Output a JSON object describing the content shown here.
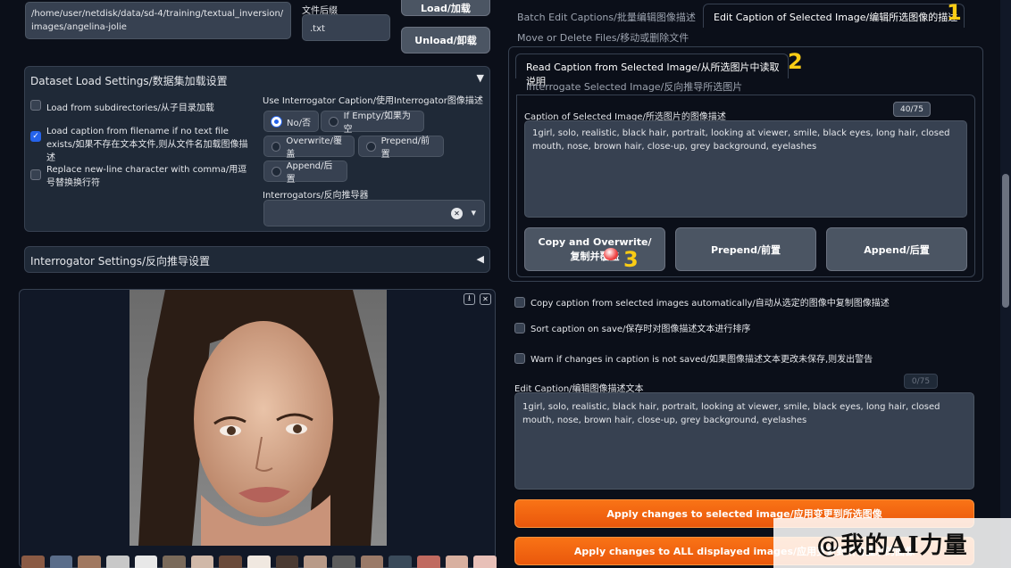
{
  "left": {
    "path_value": "/home/user/netdisk/data/sd-4/training/textual_inversion/images/angelina-jolie",
    "suffix_label": "文件后缀",
    "suffix_value": ".txt",
    "load_button": "Load/加载",
    "unload_button": "Unload/卸载",
    "dataset_settings": {
      "title": "Dataset Load Settings/数据集加载设置",
      "options": [
        {
          "label": "Load from subdirectories/从子目录加载",
          "checked": false
        },
        {
          "label": "Load caption from filename if no text file exists/如果不存在文本文件,则从文件名加载图像描述",
          "checked": true
        },
        {
          "label": "Replace new-line character with comma/用逗号替换换行符",
          "checked": false
        }
      ],
      "interrogator_caption_label": "Use Interrogator Caption/使用Interrogator图像描述",
      "radio_options": [
        "No/否",
        "If Empty/如果为空",
        "Overwrite/覆盖",
        "Prepend/前置",
        "Append/后置"
      ],
      "interrogators_label": "Interrogators/反向推导器"
    },
    "interrogator_settings": {
      "title": "Interrogator Settings/反向推导设置"
    }
  },
  "right": {
    "tabs": [
      "Batch Edit Captions/批量编辑图像描述",
      "Edit Caption of Selected Image/编辑所选图像的描述",
      "Move or Delete Files/移动或删除文件"
    ],
    "subtabs": [
      "Read Caption from Selected Image/从所选图片中读取说明",
      "Interrogate Selected Image/反向推导所选图片"
    ],
    "caption_label": "Caption of Selected Image/所选图片的图像描述",
    "caption_counter": "40/75",
    "caption_text": "1girl, solo, realistic, black hair, portrait, looking at viewer, smile, black eyes, long hair, closed mouth, nose, brown hair, close-up, grey background, eyelashes",
    "action_buttons": [
      "Copy and Overwrite/复制并覆盖",
      "Prepend/前置",
      "Append/后置"
    ],
    "checkboxes": [
      "Copy caption from selected images automatically/自动从选定的图像中复制图像描述",
      "Sort caption on save/保存时对图像描述文本进行排序",
      "Warn if changes in caption is not saved/如果图像描述文本更改未保存,则发出警告"
    ],
    "edit_label": "Edit Caption/编辑图像描述文本",
    "edit_counter": "0/75",
    "edit_text": "1girl, solo, realistic, black hair, portrait, looking at viewer, smile, black eyes, long hair, closed mouth, nose, brown hair, close-up, grey background, eyelashes",
    "apply_selected": "Apply changes to selected image/应用变更到所选图像",
    "apply_all": "Apply changes to ALL displayed images/应用变更到所有显示的图像"
  },
  "annotations": {
    "n1": "1",
    "n2": "2",
    "n3": "3"
  },
  "watermark": "@我的AI力量",
  "icons": {
    "triangle_down": "▼",
    "triangle_left": "◀",
    "download": "⭳",
    "close": "✕",
    "clear": "✕",
    "dropdown": "▾",
    "check": "✓"
  }
}
